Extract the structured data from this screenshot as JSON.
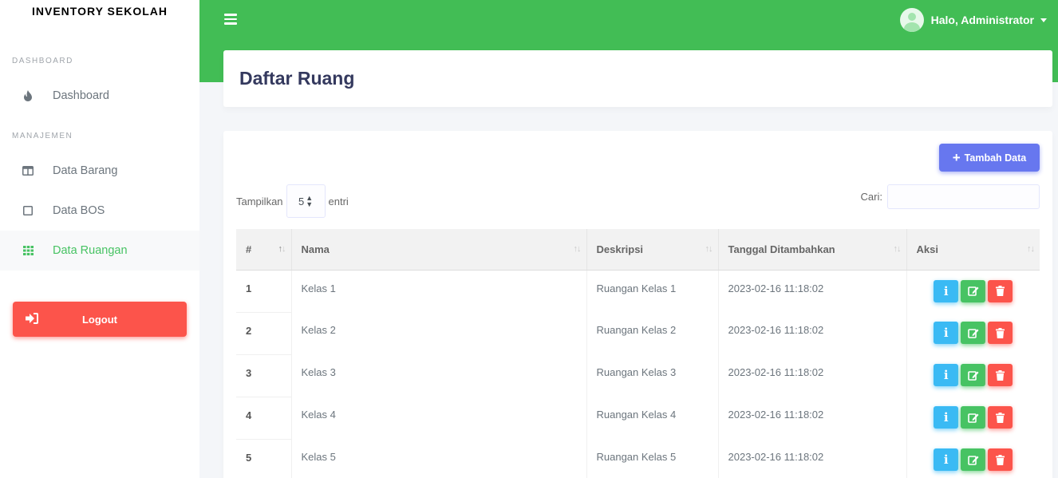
{
  "app": {
    "brand": "INVENTORY SEKOLAH"
  },
  "sidebar": {
    "section_dashboard": "DASHBOARD",
    "section_manajemen": "MANAJEMEN",
    "items": [
      {
        "label": "Dashboard",
        "icon": "fire-icon"
      },
      {
        "label": "Data Barang",
        "icon": "columns-icon"
      },
      {
        "label": "Data BOS",
        "icon": "square-icon"
      },
      {
        "label": "Data Ruangan",
        "icon": "grid-icon",
        "active": true
      }
    ],
    "logout_label": "Logout"
  },
  "topbar": {
    "user_label": "Halo, Administrator"
  },
  "page": {
    "title": "Daftar Ruang"
  },
  "toolbar": {
    "add_label": "Tambah Data"
  },
  "datatable": {
    "length_prefix": "Tampilkan",
    "length_value": "5",
    "length_suffix": "entri",
    "search_label": "Cari:",
    "search_value": "",
    "columns": [
      "#",
      "Nama",
      "Deskripsi",
      "Tanggal Ditambahkan",
      "Aksi"
    ],
    "rows": [
      {
        "no": "1",
        "nama": "Kelas 1",
        "deskripsi": "Ruangan Kelas 1",
        "tanggal": "2023-02-16 11:18:02"
      },
      {
        "no": "2",
        "nama": "Kelas 2",
        "deskripsi": "Ruangan Kelas 2",
        "tanggal": "2023-02-16 11:18:02"
      },
      {
        "no": "3",
        "nama": "Kelas 3",
        "deskripsi": "Ruangan Kelas 3",
        "tanggal": "2023-02-16 11:18:02"
      },
      {
        "no": "4",
        "nama": "Kelas 4",
        "deskripsi": "Ruangan Kelas 4",
        "tanggal": "2023-02-16 11:18:02"
      },
      {
        "no": "5",
        "nama": "Kelas 5",
        "deskripsi": "Ruangan Kelas 5",
        "tanggal": "2023-02-16 11:18:02"
      }
    ]
  },
  "colors": {
    "primary_green": "#42bd55",
    "accent_blue": "#6777ef",
    "danger": "#fc544b",
    "info": "#3abaf4",
    "success": "#47c363"
  }
}
